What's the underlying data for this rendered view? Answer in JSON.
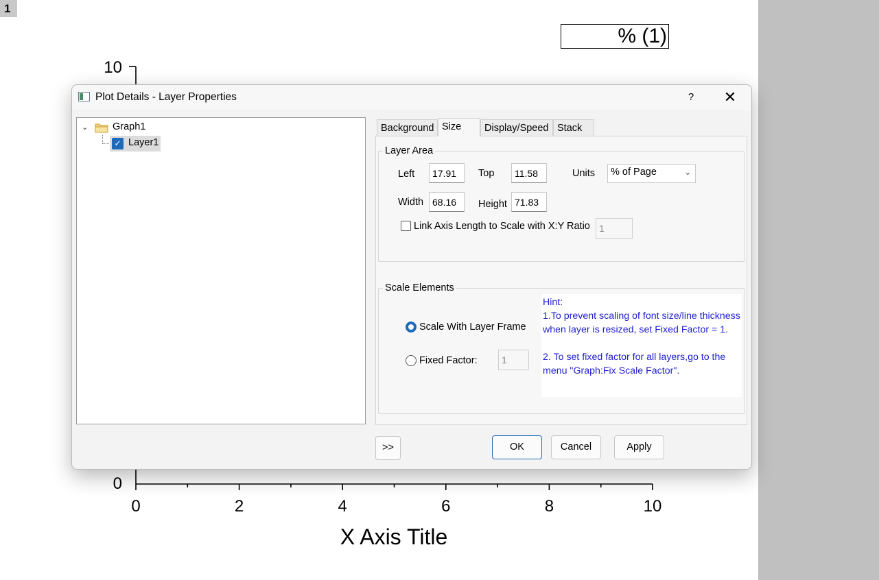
{
  "graph": {
    "layer_badge": "1",
    "legend_text": "% (1)",
    "x_axis_title": "X Axis Title",
    "x_ticks": [
      "0",
      "2",
      "4",
      "6",
      "8",
      "10"
    ],
    "y_ticks_visible": [
      "10",
      "0"
    ]
  },
  "dialog": {
    "title": "Plot Details - Layer Properties",
    "help_label": "?",
    "close_label": "✕",
    "tree": {
      "expand_glyph": "⌄",
      "graph_label": "Graph1",
      "layer_label": "Layer1",
      "layer_checked": true
    },
    "tabs": [
      "Background",
      "Size",
      "Display/Speed",
      "Stack"
    ],
    "active_tab": "Size",
    "layer_area": {
      "legend": "Layer Area",
      "left_label": "Left",
      "left_value": "17.91",
      "top_label": "Top",
      "top_value": "11.58",
      "units_label": "Units",
      "units_value": "% of Page",
      "width_label": "Width",
      "width_value": "68.16",
      "height_label": "Height",
      "height_value": "71.83",
      "link_label": "Link Axis Length to Scale with X:Y Ratio",
      "link_checked": false,
      "ratio_value": "1"
    },
    "scale_elements": {
      "legend": "Scale Elements",
      "scale_with_frame_label": "Scale With Layer Frame",
      "scale_with_frame_selected": true,
      "fixed_factor_label": "Fixed Factor:",
      "fixed_factor_value": "1",
      "hint": "Hint:\n1.To prevent scaling of font size/line thickness when layer is resized, set Fixed Factor = 1.\n\n2. To set fixed factor for all layers,go to the menu \"Graph:Fix Scale Factor\"."
    },
    "buttons": {
      "more": ">>",
      "ok": "OK",
      "cancel": "Cancel",
      "apply": "Apply"
    }
  }
}
